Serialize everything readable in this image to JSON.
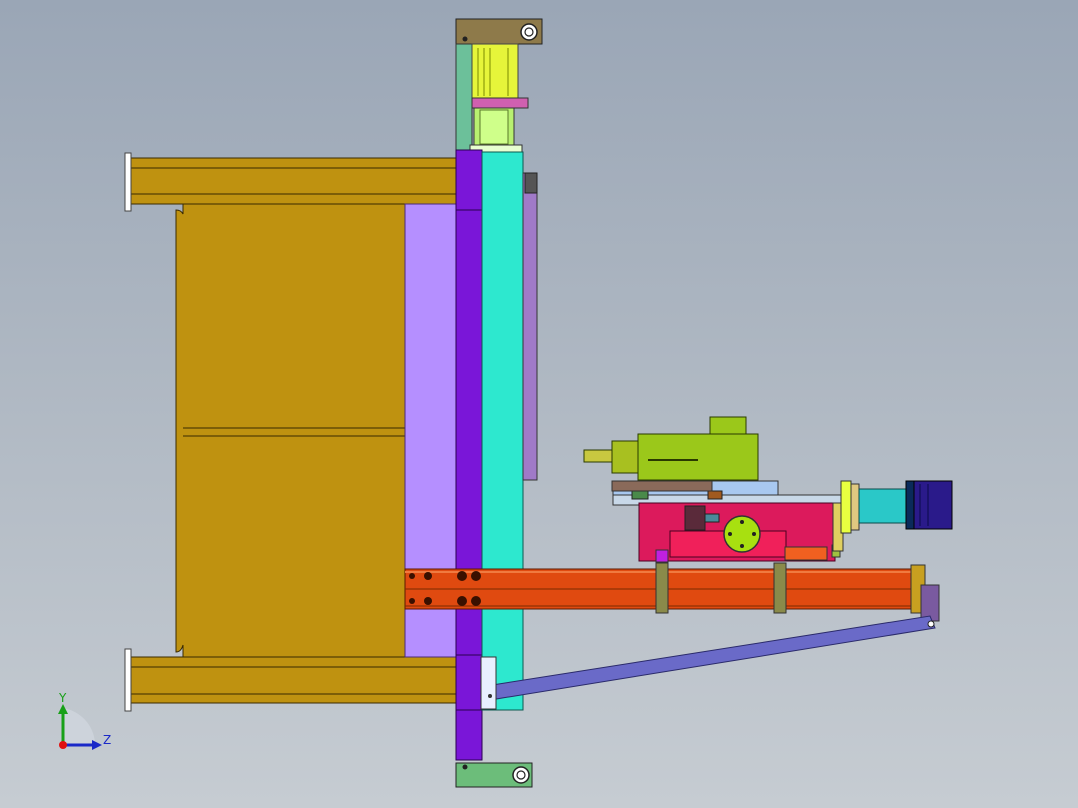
{
  "viewport": {
    "background_top": "#9aa6b6",
    "background_bottom": "#c6ccd2"
  },
  "colors": {
    "frame_gold": "#bf9210",
    "lavender_plate": "#b58fff",
    "purple_column": "#7a16d8",
    "teal_column": "#2de8cf",
    "red_cylinder": "#e04a10",
    "crimson_slide": "#dc1a5c",
    "motor_green": "#9bc81a",
    "navy_motor": "#2a1a8a",
    "link_arm": "#6a6ac8",
    "bracket_green": "#6cbd7a"
  },
  "triad": {
    "y_label": "Y",
    "z_label": "Z",
    "icon": "coordinate-triad-icon"
  }
}
